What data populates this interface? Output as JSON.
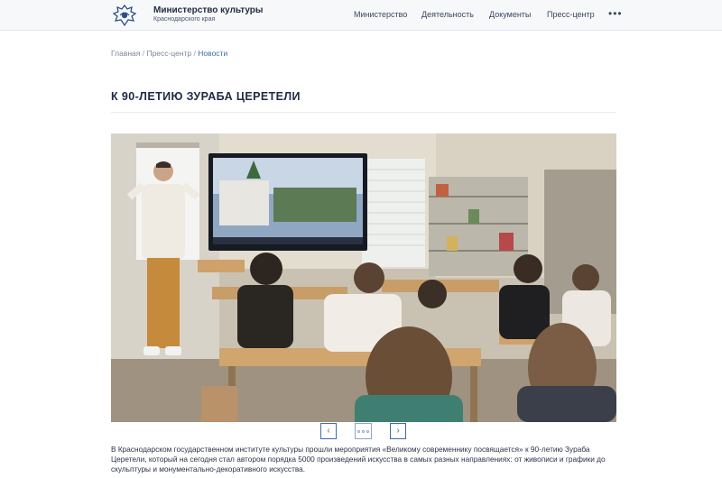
{
  "header": {
    "brand_title": "Министерство культуры",
    "brand_subtitle": "Краснодарского края",
    "nav": [
      "Министерство",
      "Деятельность",
      "Документы",
      "Пресс-центр"
    ],
    "more_label": "•••",
    "logo_icon": "coat-of-arms-icon"
  },
  "breadcrumb": {
    "items": [
      "Главная",
      "Пресс-центр",
      "Новости"
    ],
    "separator": "/"
  },
  "page_title": "К 90-ЛЕТИЮ ЗУРАБА ЦЕРЕТЕЛИ",
  "carousel": {
    "prev_icon": "chevron-left-icon",
    "next_icon": "chevron-right-icon",
    "prev_label": "‹",
    "next_label": "›"
  },
  "article_text": "В Краснодарском государственном институте культуры прошли мероприятия «Великому современнику посвящается» к 90-летию Зураба Церетели, который на сегодня стал автором порядка 5000 произведений искусства в самых разных направлениях: от живописи и графики до скульптуры и монументально-декоративного искусства.",
  "colors": {
    "accent": "#3f6da6",
    "title": "#1f2a44",
    "header_bg": "#f7f8fa"
  }
}
